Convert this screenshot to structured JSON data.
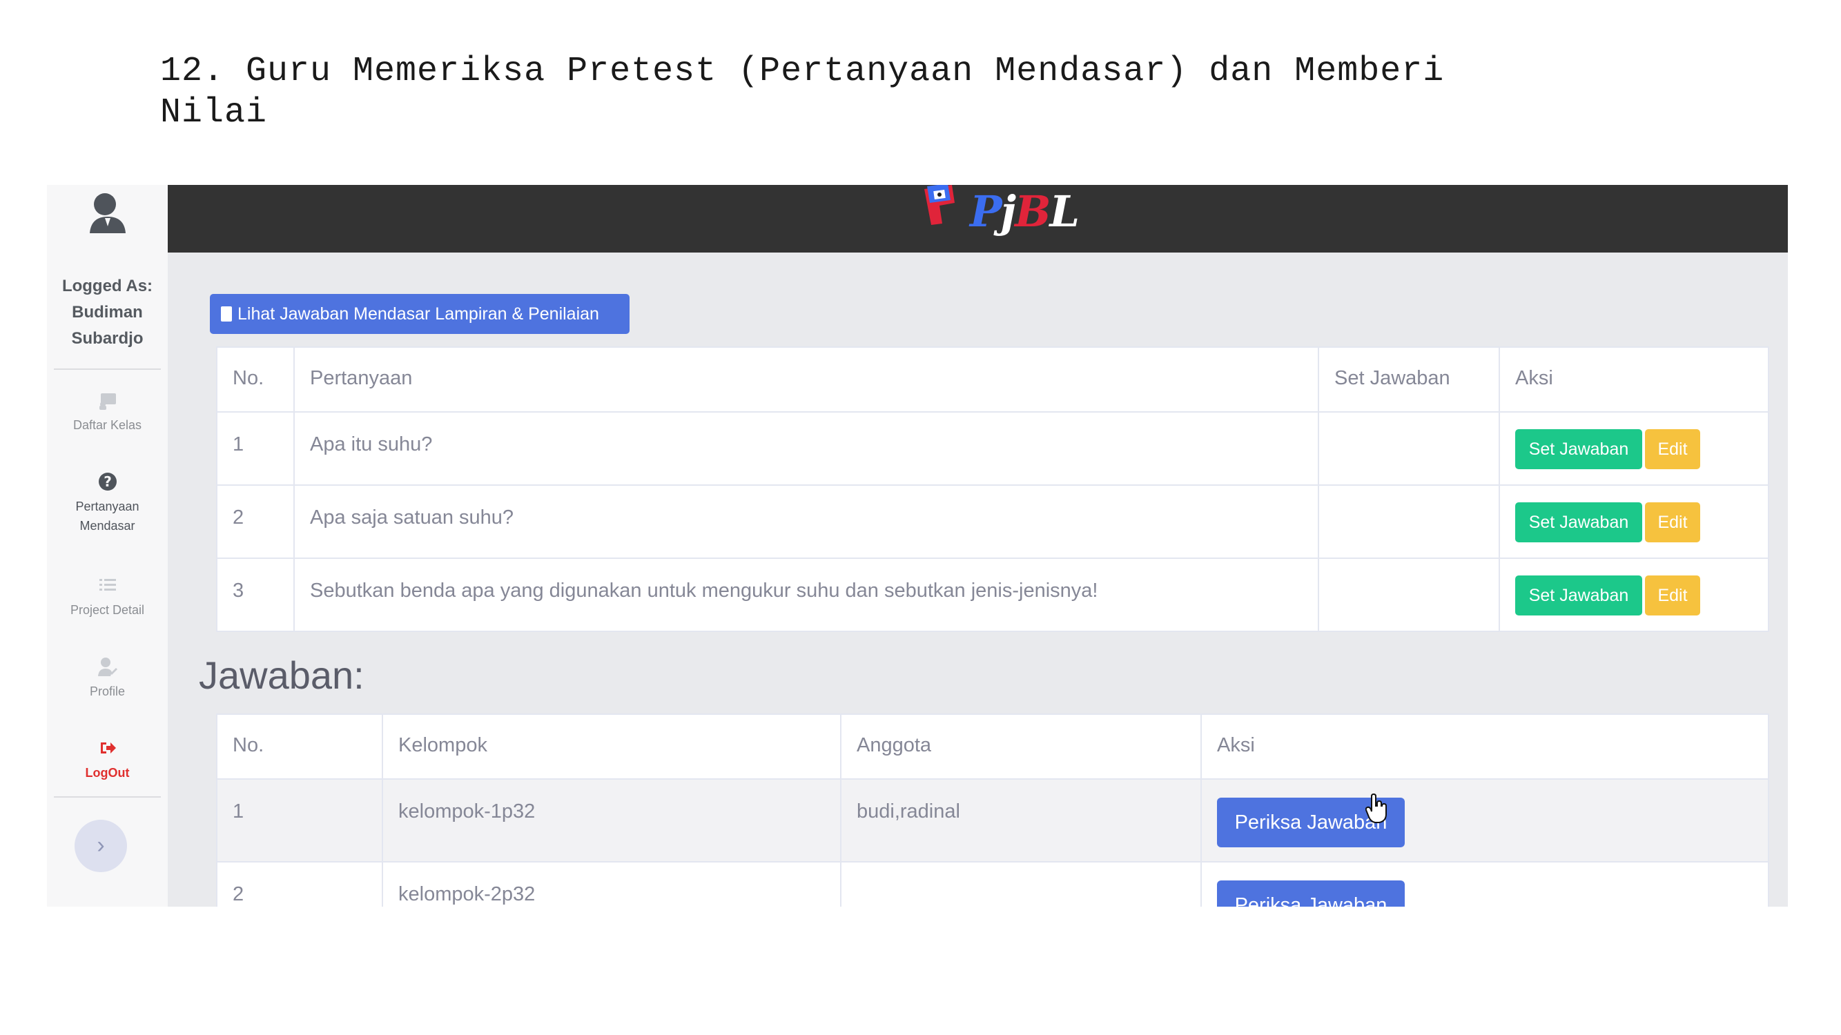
{
  "document": {
    "title": "12. Guru Memeriksa Pretest (Pertanyaan Mendasar) dan Memberi Nilai"
  },
  "sidebar": {
    "logged_as_label": "Logged As:",
    "user_first": "Budiman",
    "user_last": "Subardjo",
    "items": [
      {
        "label": "Daftar Kelas",
        "icon": "chalkboard-icon"
      },
      {
        "label_1": "Pertanyaan",
        "label_2": "Mendasar",
        "icon": "question-circle-icon"
      },
      {
        "label": "Project Detail",
        "icon": "list-icon"
      },
      {
        "label": "Profile",
        "icon": "user-edit-icon"
      },
      {
        "label": "LogOut",
        "icon": "sign-out-icon"
      }
    ],
    "toggle": "›"
  },
  "topbar": {
    "logo": {
      "p": "P",
      "j": "j",
      "b": "B",
      "l": "L"
    }
  },
  "main": {
    "lihat_button": "Lihat Jawaban Mendasar Lampiran & Penilaian",
    "questions_table": {
      "headers": [
        "No.",
        "Pertanyaan",
        "Set Jawaban",
        "Aksi"
      ],
      "rows": [
        {
          "no": "1",
          "pertanyaan": "Apa itu suhu?",
          "set_jawaban": ""
        },
        {
          "no": "2",
          "pertanyaan": "Apa saja satuan suhu?",
          "set_jawaban": ""
        },
        {
          "no": "3",
          "pertanyaan": "Sebutkan benda apa yang digunakan untuk mengukur suhu dan sebutkan jenis-jenisnya!",
          "set_jawaban": ""
        }
      ],
      "set_button": "Set Jawaban",
      "edit_button": "Edit"
    },
    "answers_heading": "Jawaban:",
    "answers_table": {
      "headers": [
        "No.",
        "Kelompok",
        "Anggota",
        "Aksi"
      ],
      "rows": [
        {
          "no": "1",
          "kelompok": "kelompok-1p32",
          "anggota": "budi,radinal"
        },
        {
          "no": "2",
          "kelompok": "kelompok-2p32",
          "anggota": ""
        }
      ],
      "periksa_button": "Periksa Jawaban"
    }
  },
  "colors": {
    "primary": "#4e73df",
    "success": "#1cc88a",
    "warning": "#f6c23e",
    "danger": "#e0302f",
    "topbar": "#333333"
  }
}
